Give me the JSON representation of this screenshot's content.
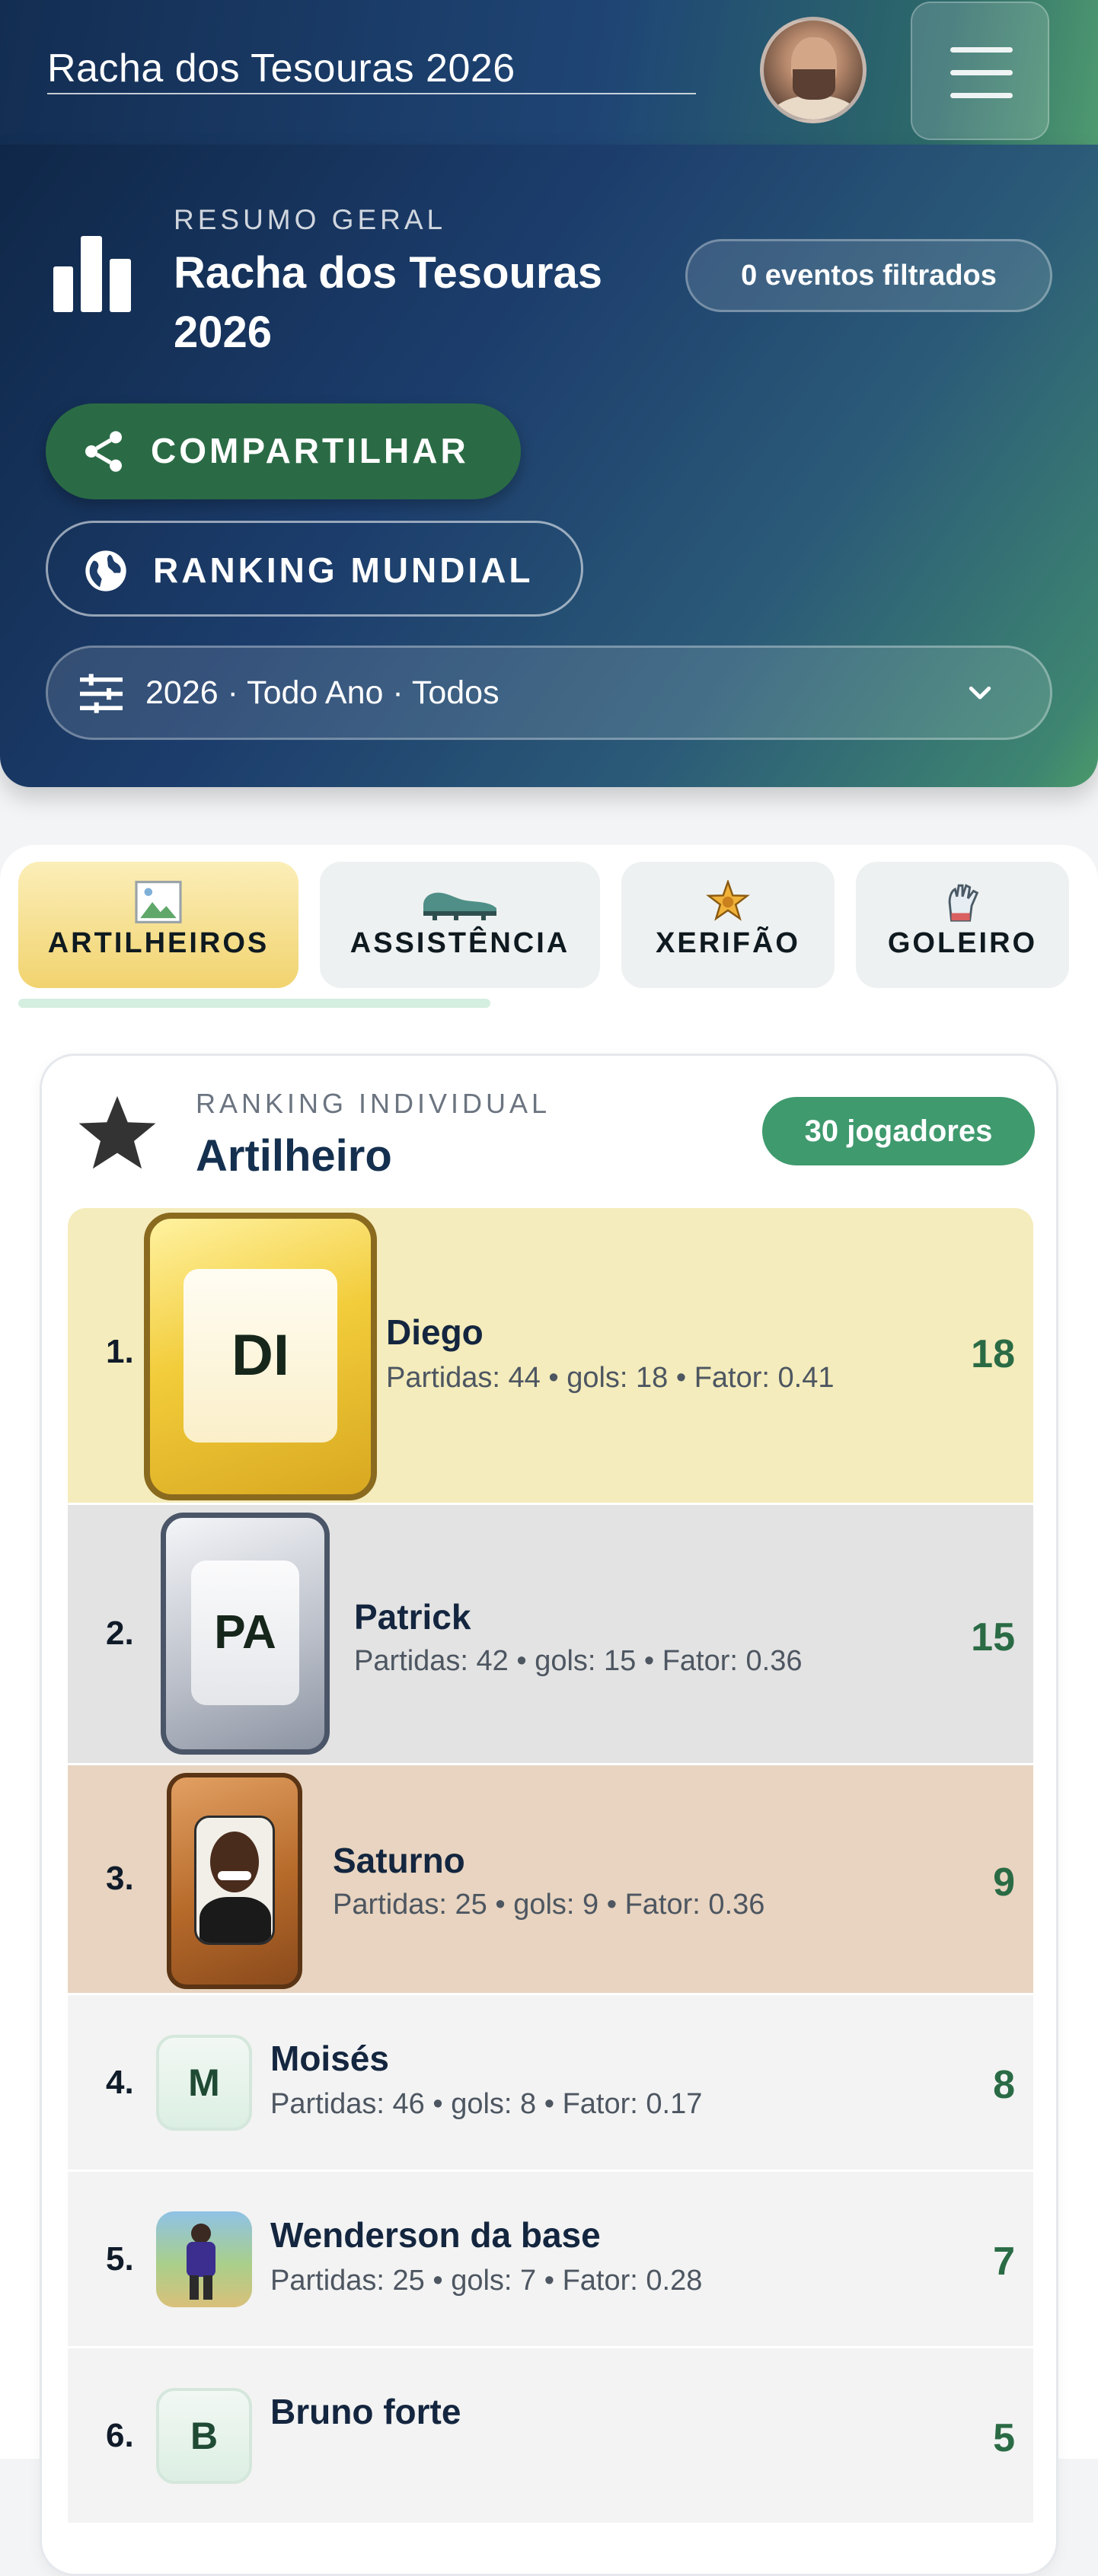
{
  "header": {
    "app_title": "Racha dos Tesouras 2026"
  },
  "hero": {
    "kicker": "RESUMO GERAL",
    "title": "Racha dos Tesouras 2026",
    "events_pill": "0 eventos filtrados",
    "share_button": "COMPARTILHAR",
    "world_ranking_button": "RANKING MUNDIAL",
    "filter_value": "2026 · Todo Ano · Todos"
  },
  "tabs": [
    {
      "label": "ARTILHEIROS",
      "icon": "broken-image-icon",
      "active": true
    },
    {
      "label": "ASSISTÊNCIA",
      "icon": "cleat-icon",
      "active": false
    },
    {
      "label": "XERIFÃO",
      "icon": "sheriff-star-icon",
      "active": false
    },
    {
      "label": "GOLEIRO",
      "icon": "goalkeeper-glove-icon",
      "active": false
    }
  ],
  "ranking": {
    "kicker": "RANKING INDIVIDUAL",
    "title": "Artilheiro",
    "count_badge": "30 jogadores",
    "rows": [
      {
        "pos": "1.",
        "initials": "DI",
        "name": "Diego",
        "meta": "Partidas: 44 • gols: 18 • Fator: 0.41",
        "value": "18"
      },
      {
        "pos": "2.",
        "initials": "PA",
        "name": "Patrick",
        "meta": "Partidas: 42 • gols: 15 • Fator: 0.36",
        "value": "15"
      },
      {
        "pos": "3.",
        "initials": "",
        "name": "Saturno",
        "meta": "Partidas: 25 • gols: 9 • Fator: 0.36",
        "value": "9"
      },
      {
        "pos": "4.",
        "initials": "M",
        "name": "Moisés",
        "meta": "Partidas: 46 • gols: 8 • Fator: 0.17",
        "value": "8"
      },
      {
        "pos": "5.",
        "initials": "",
        "name": "Wenderson da base",
        "meta": "Partidas: 25 • gols: 7 • Fator: 0.28",
        "value": "7"
      },
      {
        "pos": "6.",
        "initials": "B",
        "name": "Bruno forte",
        "meta": "",
        "value": "5"
      }
    ]
  },
  "colors": {
    "gold_row": "#f4ecbc",
    "silver_row": "#e3e3e3",
    "bronze_row": "#e8d4c0",
    "plain_row": "#f3f3f3",
    "accent_green": "#2a6b45",
    "badge_green": "#3f9a6e"
  }
}
